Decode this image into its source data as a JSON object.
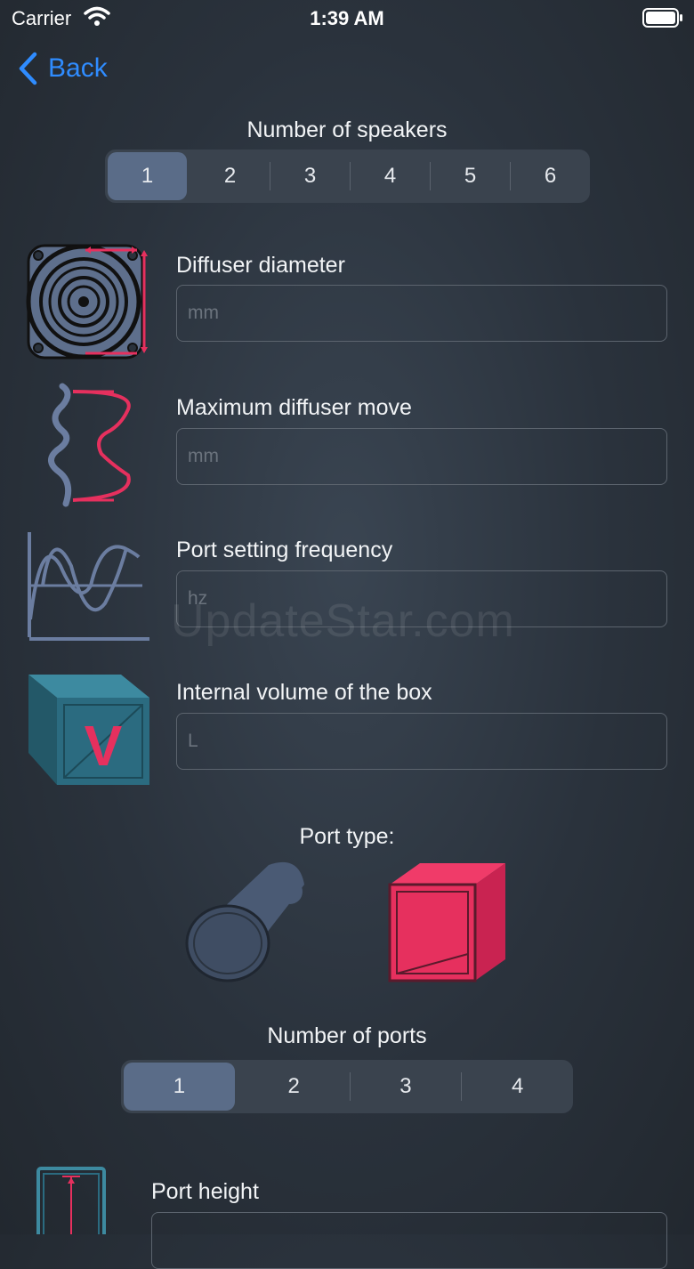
{
  "status_bar": {
    "carrier": "Carrier",
    "time": "1:39 AM"
  },
  "nav": {
    "back_label": "Back"
  },
  "speakers": {
    "title": "Number of speakers",
    "options": [
      "1",
      "2",
      "3",
      "4",
      "5",
      "6"
    ],
    "selected": "1"
  },
  "fields": {
    "diffuser_diameter": {
      "label": "Diffuser diameter",
      "placeholder": "mm"
    },
    "max_diffuser_move": {
      "label": "Maximum diffuser move",
      "placeholder": "mm"
    },
    "port_frequency": {
      "label": "Port setting frequency",
      "placeholder": "hz"
    },
    "internal_volume": {
      "label": "Internal volume of the box",
      "placeholder": "L"
    },
    "port_height": {
      "label": "Port height"
    }
  },
  "box_icon_letter": "V",
  "port_type": {
    "title": "Port type:",
    "options": [
      "round-port-icon",
      "square-port-icon"
    ],
    "selected": "square-port-icon"
  },
  "ports": {
    "title": "Number of ports",
    "options": [
      "1",
      "2",
      "3",
      "4"
    ],
    "selected": "1"
  },
  "watermark": "UpdateStar.com",
  "colors": {
    "accent_blue": "#2f8cff",
    "accent_red": "#e6305e",
    "selected_segment": "#5a6c88",
    "icon_slate": "#5e6f8c",
    "box_teal": "#2b6b80"
  }
}
